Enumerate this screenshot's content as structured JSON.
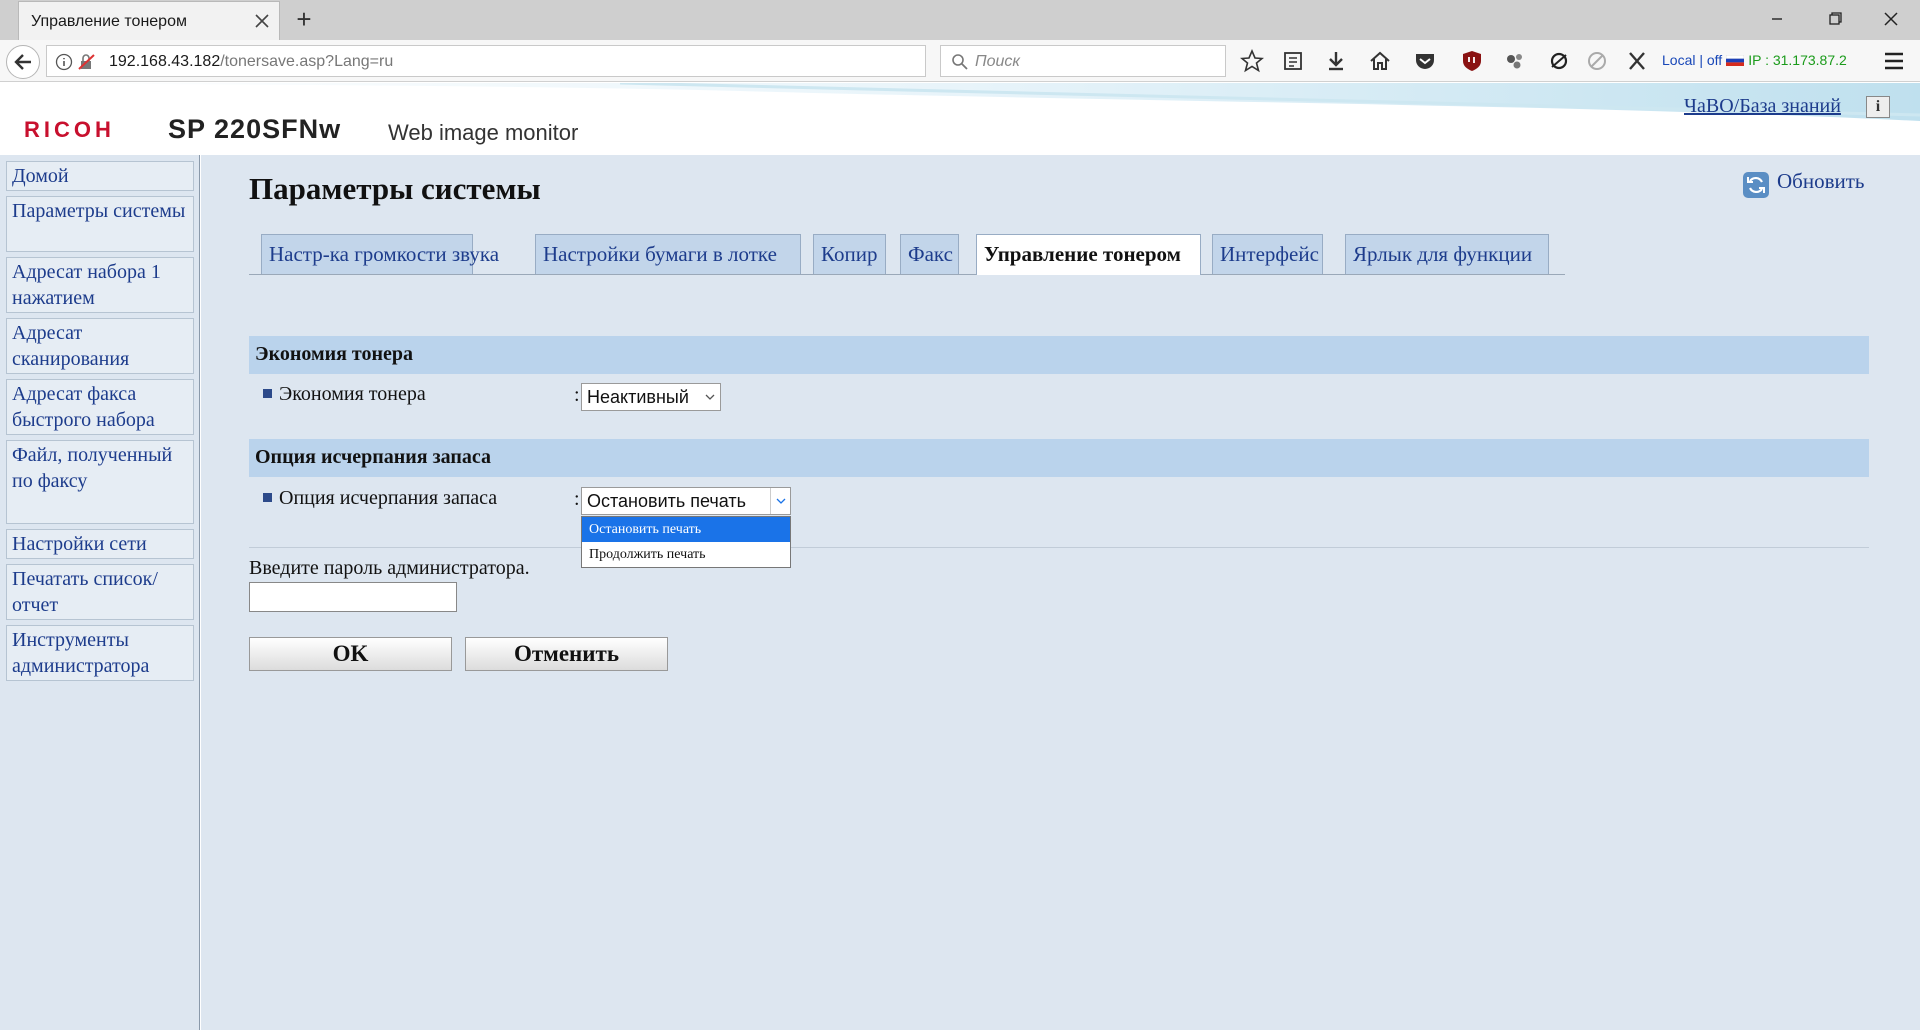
{
  "browser": {
    "tab_title": "Управление тонером",
    "url_host": "192.168.43.182",
    "url_path": "/tonersave.asp?Lang=ru",
    "search_placeholder": "Поиск",
    "ip_local": "Local | off",
    "ip_address": "IP : 31.173.87.2"
  },
  "header": {
    "brand": "RICOH",
    "model": "SP 220SFNw",
    "product": "Web image monitor",
    "faq_link": "ЧаВО/База знаний",
    "info_badge": "i"
  },
  "sidebar": {
    "items": [
      {
        "label": "Домой"
      },
      {
        "label": "Параметры системы"
      },
      {
        "label": "Адресат набора 1 нажатием"
      },
      {
        "label": "Адресат сканирования"
      },
      {
        "label": "Адресат факса быстрого набора"
      },
      {
        "label": "Файл, полученный по факсу"
      },
      {
        "label": "Настройки сети"
      },
      {
        "label": "Печатать список/отчет"
      },
      {
        "label": "Инструменты администратора"
      }
    ]
  },
  "main": {
    "title": "Параметры системы",
    "refresh_label": "Обновить",
    "tabs": [
      {
        "label": "Настр-ка громкости звука",
        "active": false
      },
      {
        "label": "Настройки бумаги в лотке",
        "active": false
      },
      {
        "label": "Копир",
        "active": false
      },
      {
        "label": "Факс",
        "active": false
      },
      {
        "label": "Управление тонером",
        "active": true
      },
      {
        "label": "Интерфейс",
        "active": false
      },
      {
        "label": "Ярлык для функции",
        "active": false
      }
    ],
    "sections": [
      {
        "title": "Экономия тонера",
        "field_label": "Экономия тонера",
        "value": "Неактивный"
      },
      {
        "title": "Опция исчерпания запаса",
        "field_label": "Опция исчерпания запаса",
        "value": "Остановить печать",
        "options": [
          "Остановить печать",
          "Продолжить печать"
        ],
        "highlighted_option": "Остановить печать"
      }
    ],
    "colon": ":",
    "password_label": "Введите пароль администратора.",
    "password_value": "",
    "ok_label": "OK",
    "cancel_label": "Отменить"
  },
  "colors": {
    "page_bg": "#dde6f0",
    "section_bar": "#bad3ec",
    "tab_bg": "#c2d5ea",
    "link": "#1d3c8c",
    "brand_red": "#c8102e",
    "dropdown_highlight": "#1a73e8"
  }
}
